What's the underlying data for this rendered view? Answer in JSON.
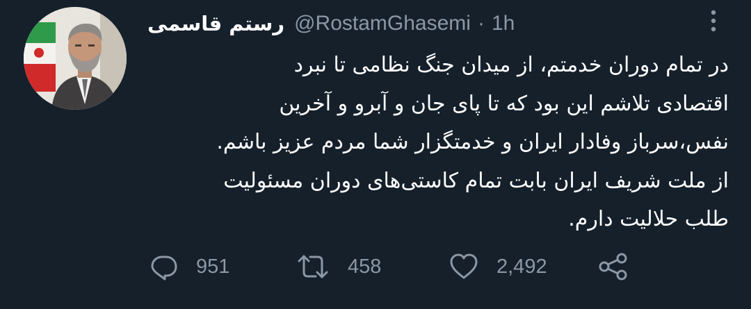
{
  "tweet": {
    "author": {
      "display_name": "رستم قاسمی",
      "handle": "@RostamGhasemi",
      "avatar": "profile-photo"
    },
    "separator": "·",
    "time": "1h",
    "more_icon": "more-vertical-icon",
    "text_lines": [
      "در تمام دوران خدمتم، از میدان جنگ نظامی تا نبرد",
      "اقتصادی تلاشم این بود که تا پای جان و آبرو و آخرین",
      "نفس،سرباز وفادار ایران و خدمتگزار شما مردم عزیز باشم.",
      "از ملت شریف ایران بابت تمام کاستی‌های دوران مسئولیت",
      "طلب حلالیت دارم."
    ],
    "actions": {
      "reply": {
        "icon": "reply-icon",
        "count": "951"
      },
      "retweet": {
        "icon": "retweet-icon",
        "count": "458"
      },
      "like": {
        "icon": "heart-icon",
        "count": "2,492"
      },
      "share": {
        "icon": "share-icon"
      }
    },
    "colors": {
      "background": "#15202b",
      "text": "#ffffff",
      "secondary_text": "#8b98a5"
    }
  }
}
